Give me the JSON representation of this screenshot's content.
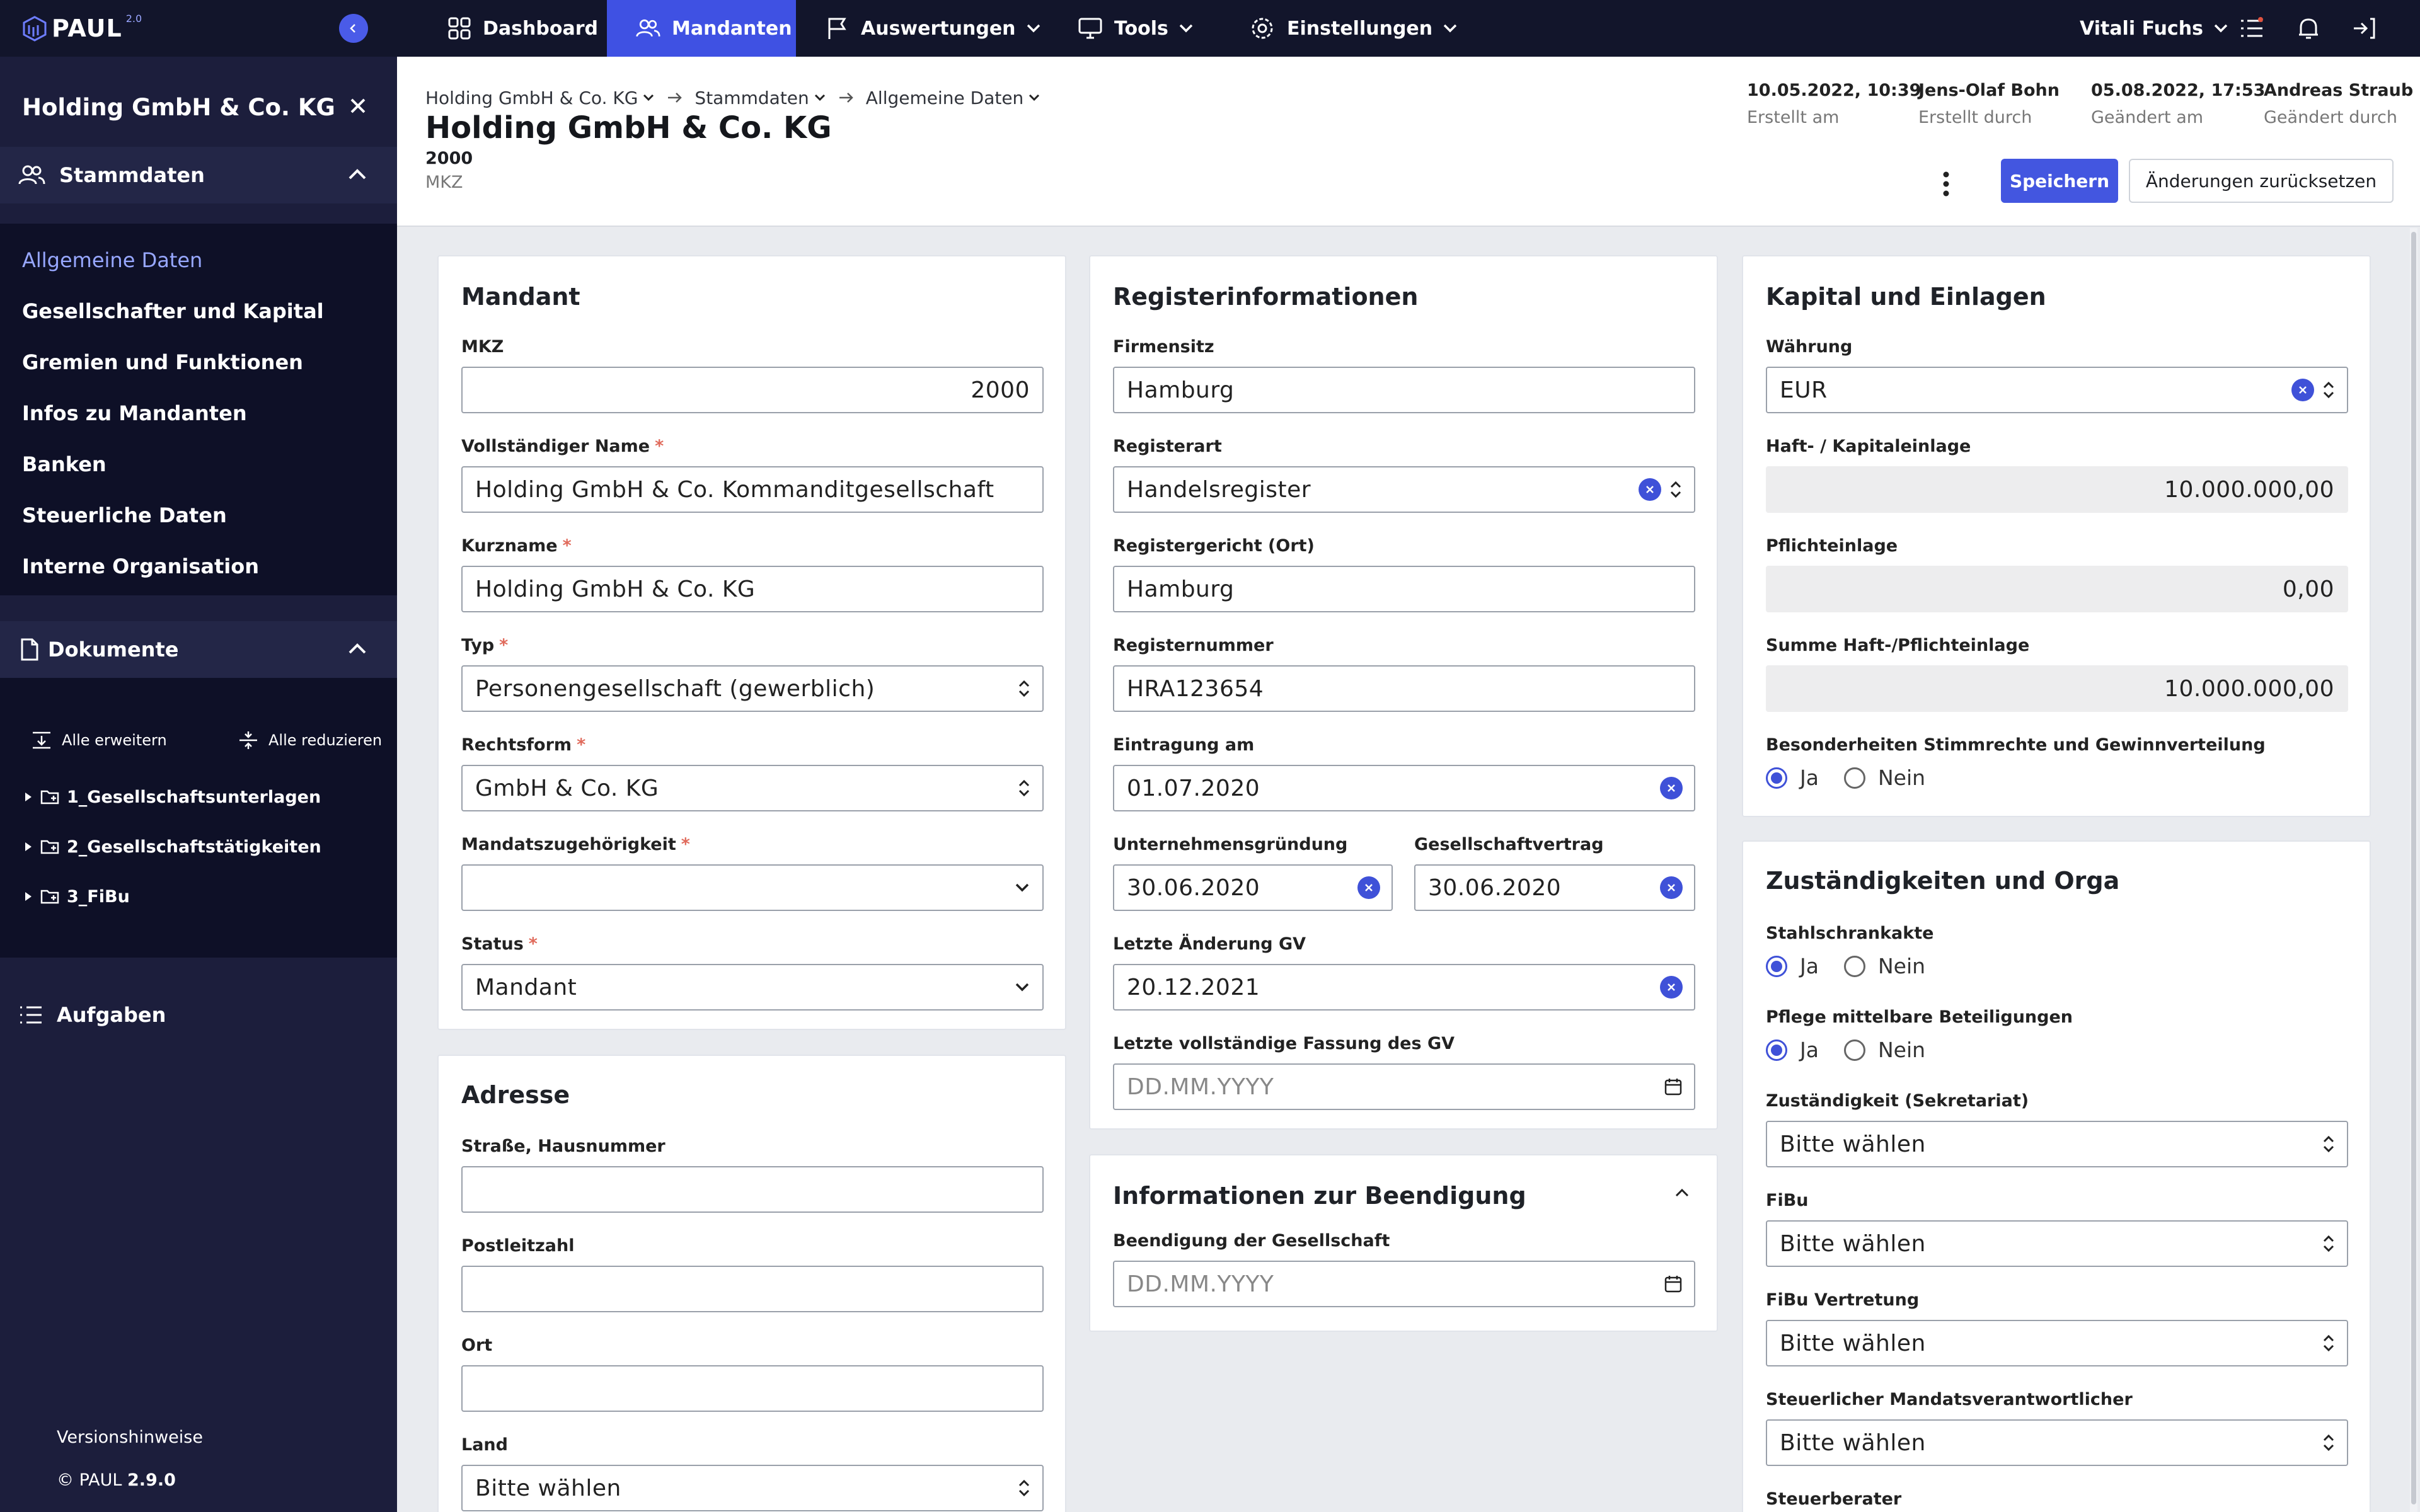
{
  "app": {
    "logo": "PAUL",
    "logo_version": "2.0"
  },
  "sidebar": {
    "company": "Holding GmbH & Co. KG",
    "stammdaten_label": "Stammdaten",
    "items": [
      {
        "label": "Allgemeine Daten",
        "active": true
      },
      {
        "label": "Gesellschafter und Kapital"
      },
      {
        "label": "Gremien und Funktionen"
      },
      {
        "label": "Infos zu Mandanten"
      },
      {
        "label": "Banken"
      },
      {
        "label": "Steuerliche Daten"
      },
      {
        "label": "Interne Organisation"
      }
    ],
    "dokumente_label": "Dokumente",
    "expand_all": "Alle erweitern",
    "collapse_all": "Alle reduzieren",
    "tree": [
      {
        "label": "1_Gesellschaftsunterlagen"
      },
      {
        "label": "2_Gesellschaftstätigkeiten"
      },
      {
        "label": "3_FiBu"
      }
    ],
    "aufgaben_label": "Aufgaben",
    "release_notes": "Versionshinweise",
    "copyright": "© PAUL",
    "version": "2.9.0"
  },
  "topbar": {
    "nav": [
      {
        "label": "Dashboard",
        "icon": "grid-icon"
      },
      {
        "label": "Mandanten",
        "icon": "users-icon",
        "active": true
      },
      {
        "label": "Auswertungen",
        "icon": "flag-icon"
      },
      {
        "label": "Tools",
        "icon": "monitor-icon"
      },
      {
        "label": "Einstellungen",
        "icon": "gear-icon"
      }
    ],
    "user": "Vitali Fuchs"
  },
  "header": {
    "breadcrumb": [
      "Holding GmbH & Co. KG",
      "Stammdaten",
      "Allgemeine Daten"
    ],
    "title": "Holding GmbH & Co. KG",
    "mkz_value": "2000",
    "mkz_label": "MKZ",
    "meta": [
      {
        "value": "10.05.2022, 10:39",
        "label": "Erstellt am"
      },
      {
        "value": "Jens-Olaf Bohn",
        "label": "Erstellt durch"
      },
      {
        "value": "05.08.2022, 17:53",
        "label": "Geändert am"
      },
      {
        "value": "Andreas Straub",
        "label": "Geändert durch"
      }
    ],
    "save": "Speichern",
    "reset": "Änderungen zurücksetzen"
  },
  "mandant": {
    "title": "Mandant",
    "mkz": {
      "label": "MKZ",
      "value": "2000"
    },
    "full_name": {
      "label": "Vollständiger Name",
      "value": "Holding GmbH & Co. Kommanditgesellschaft"
    },
    "short_name": {
      "label": "Kurzname",
      "value": "Holding GmbH & Co. KG"
    },
    "type": {
      "label": "Typ",
      "value": "Personengesellschaft (gewerblich)"
    },
    "legal_form": {
      "label": "Rechtsform",
      "value": "GmbH & Co. KG"
    },
    "membership": {
      "label": "Mandatszugehörigkeit",
      "value": ""
    },
    "status": {
      "label": "Status",
      "value": "Mandant"
    }
  },
  "adresse": {
    "title": "Adresse",
    "street": {
      "label": "Straße, Hausnummer",
      "value": ""
    },
    "zip": {
      "label": "Postleitzahl",
      "value": ""
    },
    "city": {
      "label": "Ort",
      "value": ""
    },
    "country": {
      "label": "Land",
      "value": "Bitte wählen"
    }
  },
  "register": {
    "title": "Registerinformationen",
    "seat": {
      "label": "Firmensitz",
      "value": "Hamburg"
    },
    "kind": {
      "label": "Registerart",
      "value": "Handelsregister"
    },
    "court": {
      "label": "Registergericht (Ort)",
      "value": "Hamburg"
    },
    "number": {
      "label": "Registernummer",
      "value": "HRA123654"
    },
    "entry": {
      "label": "Eintragung am",
      "value": "01.07.2020"
    },
    "founding": {
      "label": "Unternehmensgründung",
      "value": "30.06.2020"
    },
    "contract": {
      "label": "Gesellschaftvertrag",
      "value": "30.06.2020"
    },
    "last_change": {
      "label": "Letzte Änderung GV",
      "value": "20.12.2021"
    },
    "last_full": {
      "label": "Letzte vollständige Fassung des GV",
      "placeholder": "DD.MM.YYYY"
    }
  },
  "beendigung": {
    "title": "Informationen zur Beendigung",
    "end": {
      "label": "Beendigung der Gesellschaft",
      "placeholder": "DD.MM.YYYY"
    }
  },
  "kapital": {
    "title": "Kapital und Einlagen",
    "currency": {
      "label": "Währung",
      "value": "EUR"
    },
    "liability": {
      "label": "Haft- / Kapitaleinlage",
      "value": "10.000.000,00"
    },
    "mandatory": {
      "label": "Pflichteinlage",
      "value": "0,00"
    },
    "sum": {
      "label": "Summe Haft-/Pflichteinlage",
      "value": "10.000.000,00"
    },
    "special": {
      "label": "Besonderheiten Stimmrechte und Gewinnverteilung",
      "yes": "Ja",
      "no": "Nein",
      "selected": "Ja"
    }
  },
  "orga": {
    "title": "Zuständigkeiten und Orga",
    "steel": {
      "label": "Stahlschrankakte",
      "yes": "Ja",
      "no": "Nein",
      "selected": "Ja"
    },
    "indirect": {
      "label": "Pflege mittelbare Beteiligungen",
      "yes": "Ja",
      "no": "Nein",
      "selected": "Ja"
    },
    "secretariat": {
      "label": "Zuständigkeit (Sekretariat)",
      "value": "Bitte wählen"
    },
    "fibu": {
      "label": "FiBu",
      "value": "Bitte wählen"
    },
    "fibu_sub": {
      "label": "FiBu Vertretung",
      "value": "Bitte wählen"
    },
    "tax_resp": {
      "label": "Steuerlicher Mandatsverantwortlicher",
      "value": "Bitte wählen"
    },
    "tax_advisor": {
      "label": "Steuerberater"
    }
  },
  "colors": {
    "accent": "#3f51e3",
    "sidebar": "#1c1e3c",
    "topbar": "#12152b"
  }
}
